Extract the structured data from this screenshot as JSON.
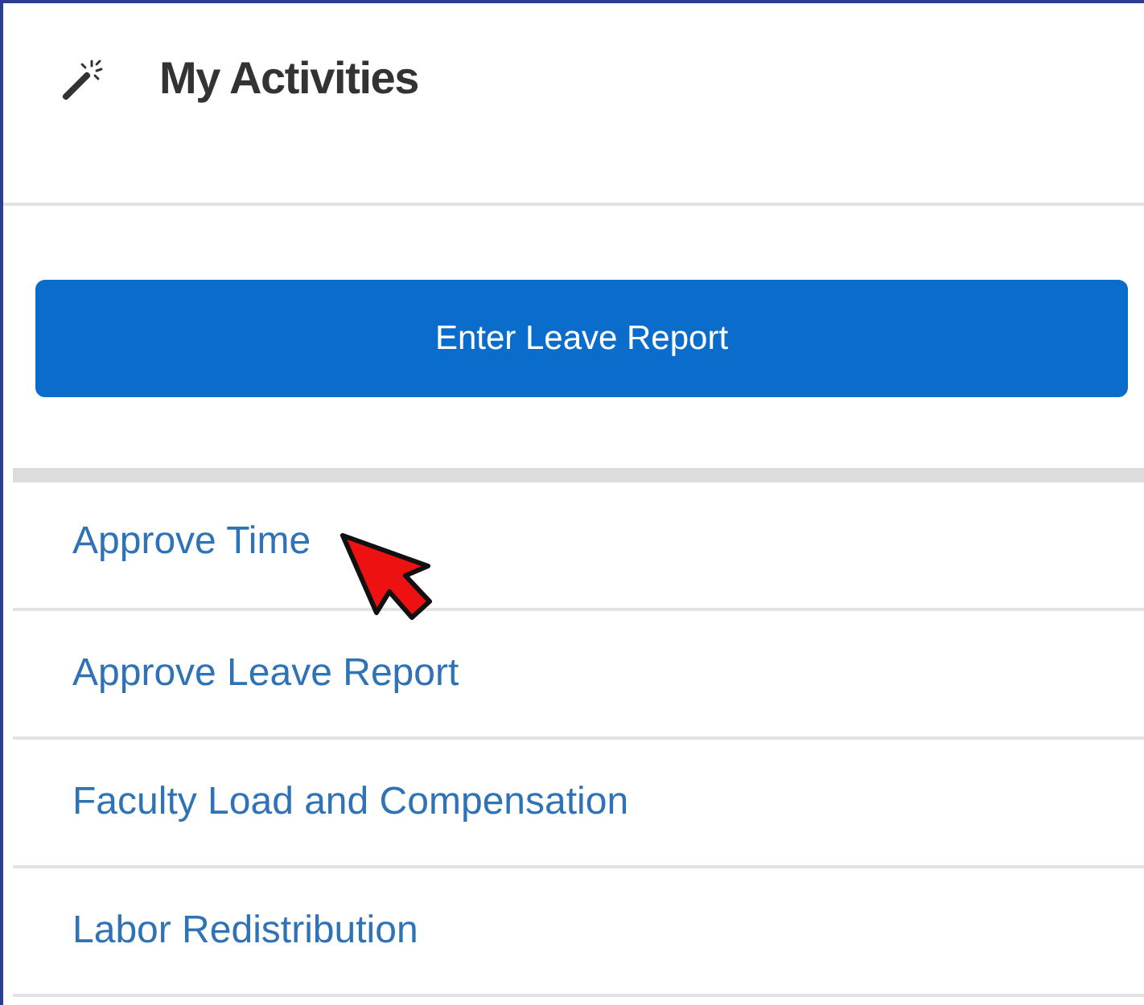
{
  "panel": {
    "title": "My Activities"
  },
  "primary_action": {
    "label": "Enter Leave Report"
  },
  "activities": [
    {
      "label": "Approve Time",
      "pointed": true
    },
    {
      "label": "Approve Leave Report",
      "pointed": false
    },
    {
      "label": "Faculty Load and Compensation",
      "pointed": false
    },
    {
      "label": "Labor Redistribution",
      "pointed": false
    }
  ]
}
